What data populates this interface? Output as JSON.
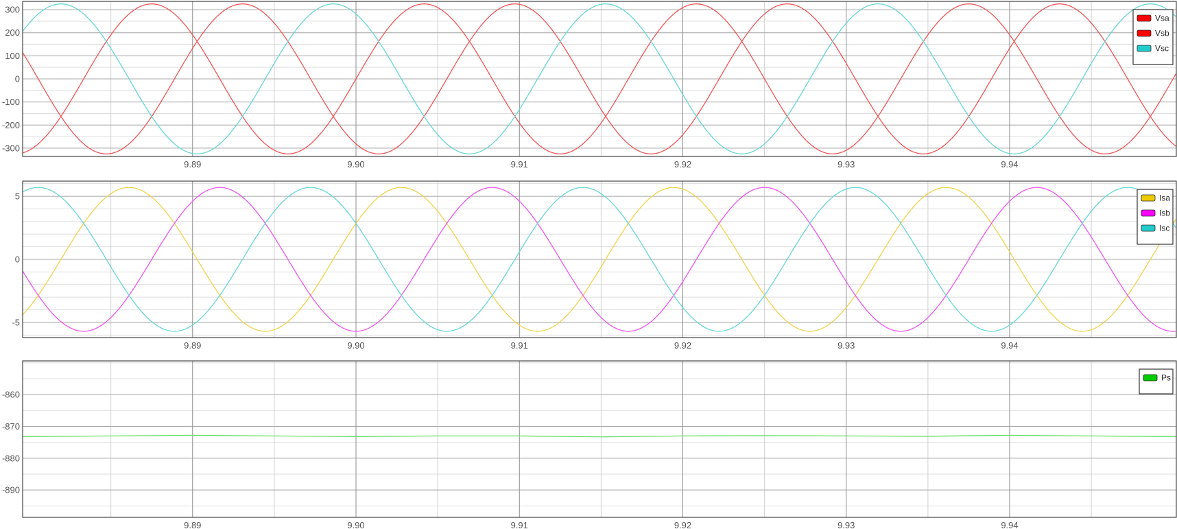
{
  "chart_data": [
    {
      "type": "line",
      "x_range": [
        9.8796,
        9.9502
      ],
      "x_ticks": [
        9.89,
        9.9,
        9.91,
        9.92,
        9.93,
        9.94
      ],
      "x_tick_labels": [
        "9.89",
        "9.90",
        "9.91",
        "9.92",
        "9.93",
        "9.94"
      ],
      "ylim": [
        -336,
        336
      ],
      "y_ticks": [
        300,
        200,
        100,
        0,
        -100,
        -200,
        -300
      ],
      "y_tick_labels": [
        "300",
        "200",
        "100",
        "0",
        "-100",
        "-200",
        "-300"
      ],
      "y_minor_step": 50,
      "grid": true,
      "legend_position": "top-right",
      "frequency_hz": 60,
      "series": [
        {
          "name": "Vsa",
          "color": "#ff0000",
          "line_color": "#ee5555",
          "amplitude": 325,
          "phase_deg": 0
        },
        {
          "name": "Vsb",
          "color": "#ff0000",
          "line_color": "#ee5555",
          "amplitude": 325,
          "phase_deg": -120
        },
        {
          "name": "Vsc",
          "color": "#22cccc",
          "line_color": "#66d6d6",
          "amplitude": 325,
          "phase_deg": 120
        }
      ]
    },
    {
      "type": "line",
      "x_range": [
        9.8796,
        9.9502
      ],
      "x_ticks": [
        9.89,
        9.9,
        9.91,
        9.92,
        9.93,
        9.94
      ],
      "x_tick_labels": [
        "9.89",
        "9.90",
        "9.91",
        "9.92",
        "9.93",
        "9.94"
      ],
      "ylim": [
        -6.2,
        6.2
      ],
      "y_ticks": [
        5,
        0,
        -5
      ],
      "y_tick_labels": [
        "5",
        "0",
        "-5"
      ],
      "y_minor_step": 1,
      "grid": true,
      "legend_position": "top-right",
      "frequency_hz": 60,
      "series": [
        {
          "name": "Isa",
          "color": "#eecc00",
          "line_color": "#f2d24a",
          "amplitude": 5.7,
          "phase_deg": 30
        },
        {
          "name": "Isb",
          "color": "#ff00ff",
          "line_color": "#ee55ee",
          "amplitude": 5.7,
          "phase_deg": -90
        },
        {
          "name": "Isc",
          "color": "#22cccc",
          "line_color": "#66d6d6",
          "amplitude": 5.7,
          "phase_deg": 150
        }
      ]
    },
    {
      "type": "line",
      "x_range": [
        9.8796,
        9.9502
      ],
      "x_ticks": [
        9.89,
        9.9,
        9.91,
        9.92,
        9.93,
        9.94
      ],
      "x_tick_labels": [
        "9.89",
        "9.90",
        "9.91",
        "9.92",
        "9.93",
        "9.94"
      ],
      "ylim": [
        -898.6,
        -849.4
      ],
      "y_ticks": [
        -860,
        -870,
        -880,
        -890
      ],
      "y_tick_labels": [
        "-860",
        "-870",
        "-880",
        "-890"
      ],
      "y_minor_step": 5,
      "grid": true,
      "legend_position": "top-right",
      "series": [
        {
          "name": "Ps",
          "color": "#00cc00",
          "line_color": "#66dd66",
          "x": [
            9.8796,
            9.885,
            9.89,
            9.895,
            9.9,
            9.905,
            9.91,
            9.915,
            9.92,
            9.925,
            9.93,
            9.935,
            9.94,
            9.945,
            9.9502
          ],
          "y": [
            -873.2,
            -873.0,
            -872.8,
            -873.0,
            -873.2,
            -873.0,
            -873.0,
            -873.3,
            -873.0,
            -872.9,
            -873.0,
            -873.1,
            -872.8,
            -873.0,
            -873.2
          ]
        }
      ]
    }
  ]
}
